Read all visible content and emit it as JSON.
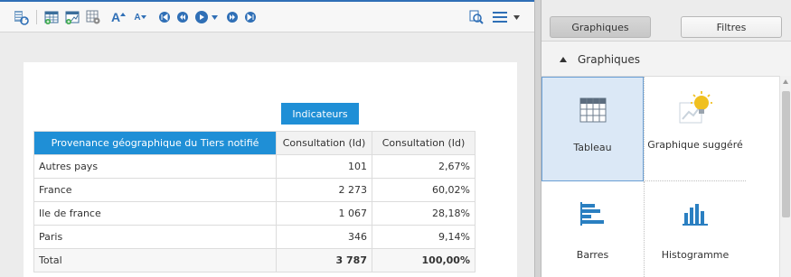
{
  "toolbar": {
    "icons": [
      "refresh-data-icon",
      "add-table-icon",
      "add-chart-icon",
      "settings-grid-icon",
      "font-increase-icon",
      "font-decrease-icon",
      "first-page-icon",
      "previous-page-icon",
      "play-icon",
      "dropdown-icon",
      "next-page-icon",
      "last-page-icon",
      "zoom-icon",
      "menu-icon",
      "dropdown-icon"
    ],
    "font_increase_label": "A",
    "font_decrease_label": "A"
  },
  "report": {
    "measure_group_header": "Indicateurs",
    "dimension_header": "Provenance géographique du Tiers notifié",
    "measure_headers": [
      "Consultation (Id)",
      "Consultation (Id)"
    ],
    "rows": [
      {
        "label": "Autres pays",
        "value": "101",
        "percent": "2,67%"
      },
      {
        "label": "France",
        "value": "2 273",
        "percent": "60,02%"
      },
      {
        "label": "Ile de france",
        "value": "1 067",
        "percent": "28,18%"
      },
      {
        "label": "Paris",
        "value": "346",
        "percent": "9,14%"
      },
      {
        "label": "Total",
        "value": "3 787",
        "percent": "100,00%"
      }
    ]
  },
  "right_panel": {
    "tabs": [
      {
        "label": "Graphiques",
        "active": true
      },
      {
        "label": "Filtres",
        "active": false
      }
    ],
    "section_title": "Graphiques",
    "chart_types": [
      {
        "label": "Tableau",
        "icon": "table-grid-icon",
        "selected": true
      },
      {
        "label": "Graphique suggéré",
        "icon": "suggested-chart-bulb-icon",
        "selected": false
      },
      {
        "label": "Barres",
        "icon": "horizontal-bars-icon",
        "selected": false
      },
      {
        "label": "Histogramme",
        "icon": "vertical-bars-icon",
        "selected": false
      }
    ]
  },
  "colors": {
    "accent": "#1f8fd6",
    "toolbar_icon": "#2f6fb6",
    "selected_tile": "#dbe8f6",
    "bulb": "#f0c020"
  }
}
